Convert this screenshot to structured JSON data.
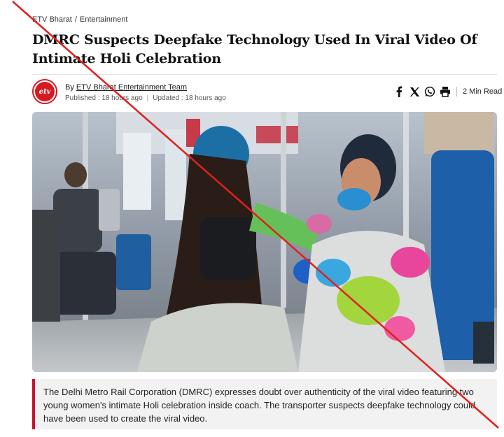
{
  "breadcrumb": {
    "site": "ETV Bharat",
    "separator": "/",
    "section": "Entertainment"
  },
  "headline": "DMRC Suspects Deepfake Technology Used In Viral Video Of Intimate Holi Celebration",
  "author": {
    "prefix": "By",
    "name": "ETV Bharat Entertainment Team",
    "logo_text": "etv"
  },
  "meta": {
    "published": "Published : 18 hours ago",
    "separator": "|",
    "updated": "Updated : 18 hours ago"
  },
  "share": {
    "icons": [
      "facebook-icon",
      "x-icon",
      "whatsapp-icon",
      "print-icon"
    ],
    "read_time": "2 Min Read"
  },
  "summary": "The Delhi Metro Rail Corporation (DMRC) expresses doubt over authenticity of the viral video featuring two young women's intimate Holi celebration inside coach. The transporter suspects deepfake technology could have been used to create the viral video.",
  "colors": {
    "accent": "#c8102e",
    "cross": "#e0201e"
  }
}
